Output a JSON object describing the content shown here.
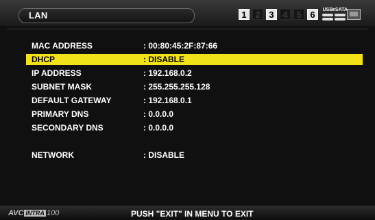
{
  "header": {
    "title": "LAN",
    "slots": [
      {
        "label": "1",
        "active": true
      },
      {
        "label": "2",
        "active": false
      },
      {
        "label": "3",
        "active": true
      },
      {
        "label": "4",
        "active": false
      },
      {
        "label": "5",
        "active": false
      },
      {
        "label": "6",
        "active": true
      }
    ],
    "usb_label": "USB",
    "esata_label": "eSATA",
    "icons": [
      "usb-drive-icon",
      "esata-drive-icon",
      "monitor-icon"
    ]
  },
  "settings": [
    {
      "label": "MAC ADDRESS",
      "value": ": 00:80:45:2F:87:66"
    },
    {
      "label": "DHCP",
      "value": ": DISABLE",
      "selected": true
    },
    {
      "label": "IP ADDRESS",
      "value": ": 192.168.0.2"
    },
    {
      "label": "SUBNET MASK",
      "value": ": 255.255.255.128"
    },
    {
      "label": "DEFAULT GATEWAY",
      "value": ": 192.168.0.1"
    },
    {
      "label": "PRIMARY DNS",
      "value": ": 0.0.0.0"
    },
    {
      "label": "SECONDARY DNS",
      "value": ": 0.0.0.0"
    },
    {
      "label": "NETWORK",
      "value": ": DISABLE"
    }
  ],
  "footer": {
    "brand_prefix": "AVC",
    "brand_box": "INTRA",
    "brand_suffix": "100",
    "hint": "PUSH \"EXIT\" IN MENU TO EXIT"
  },
  "colors": {
    "highlight": "#f2e21a",
    "background": "#101010",
    "text": "#ffffff"
  }
}
